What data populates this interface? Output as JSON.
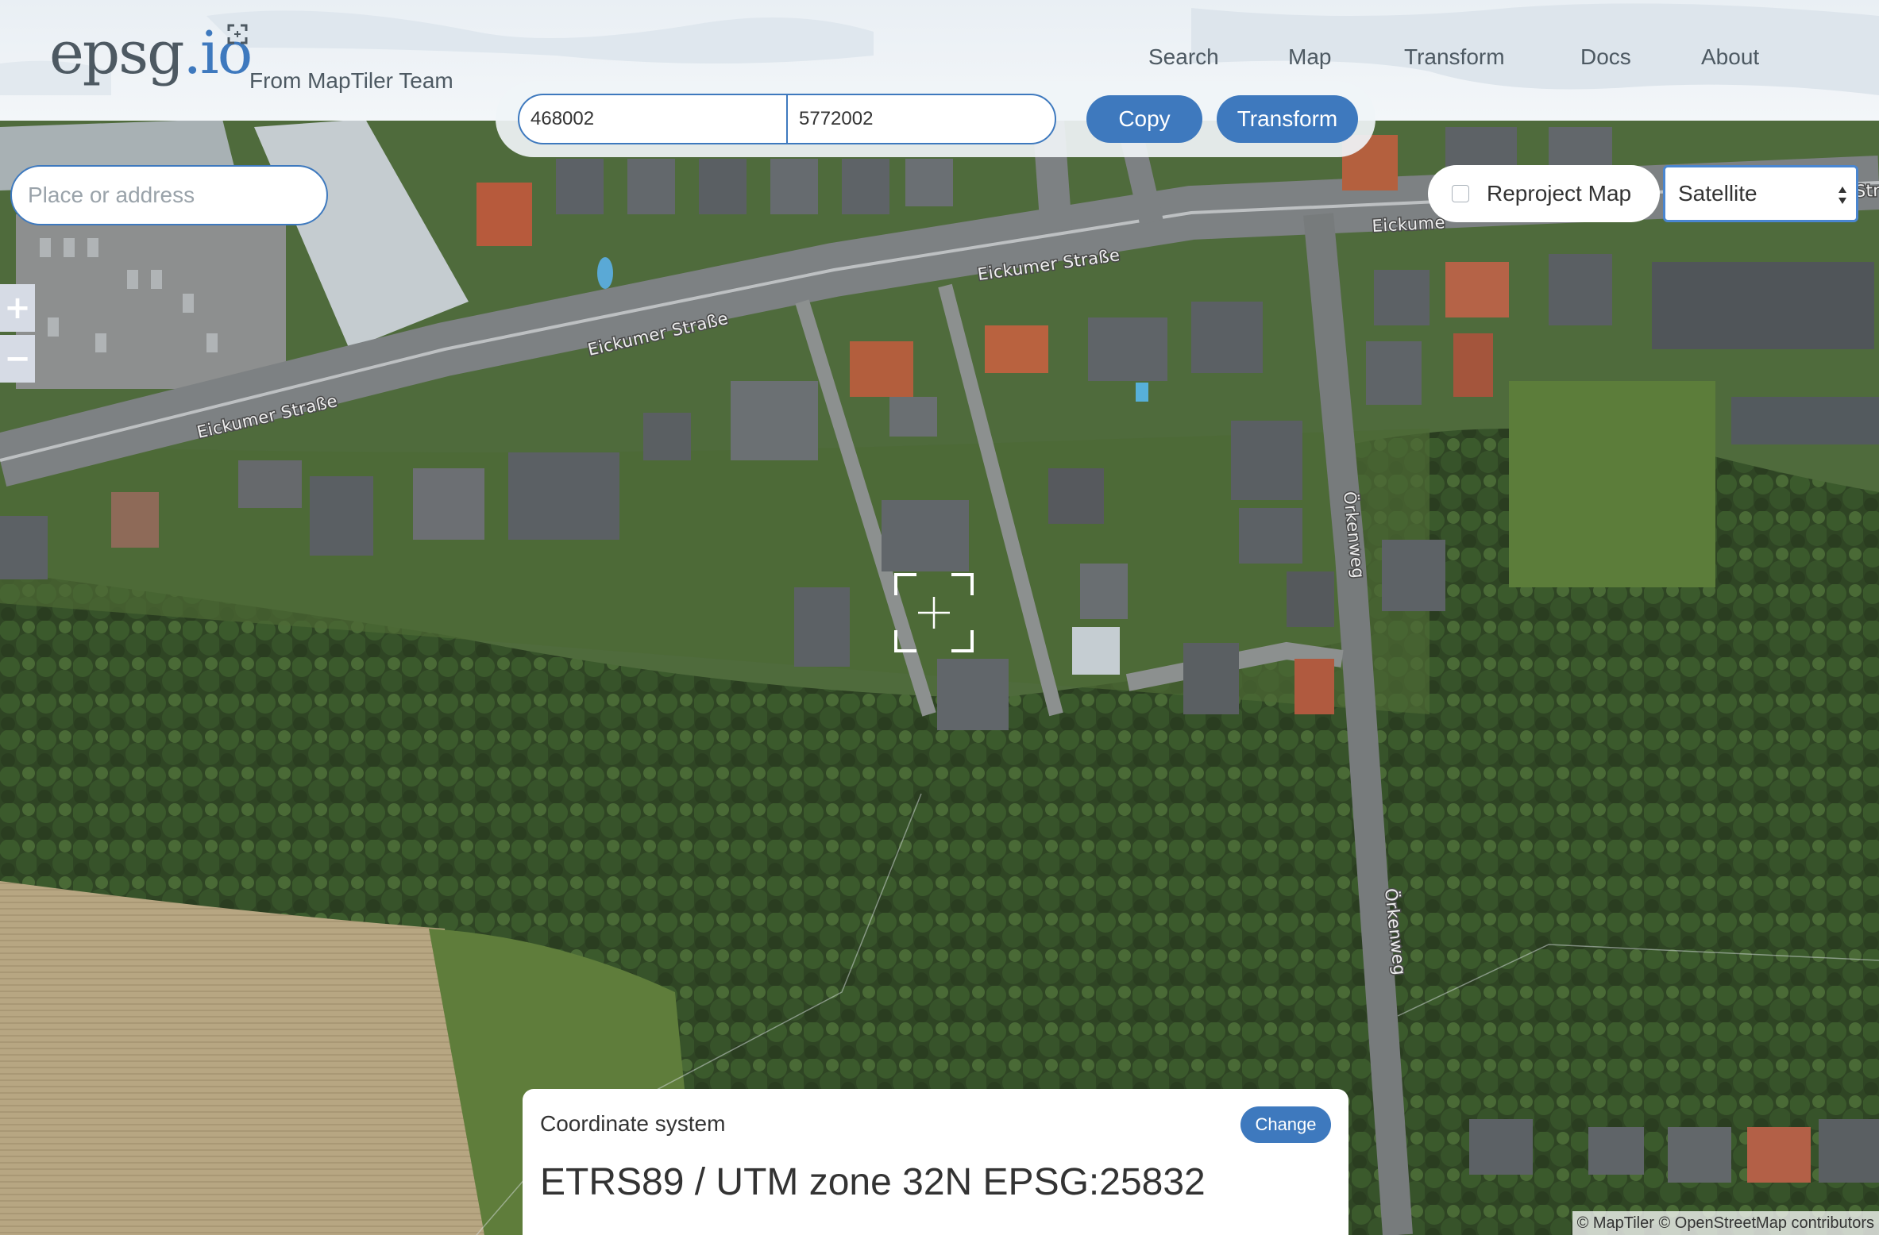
{
  "app": {
    "logo_main": "epsg",
    "logo_io": ".io",
    "tagline": "From MapTiler Team"
  },
  "nav": [
    {
      "label": "Search"
    },
    {
      "label": "Map"
    },
    {
      "label": "Transform"
    },
    {
      "label": "Docs"
    },
    {
      "label": "About"
    }
  ],
  "coords": {
    "x_value": "468002",
    "y_value": "5772002",
    "copy_label": "Copy",
    "transform_label": "Transform"
  },
  "search": {
    "placeholder": "Place or address"
  },
  "zoom": {
    "in_label": "+",
    "out_label": "−"
  },
  "map_controls": {
    "reproject_label": "Reproject Map",
    "reproject_checked": false,
    "layer_selected": "Satellite"
  },
  "streets": {
    "eickumer_1": "Eickumer Straße",
    "eickumer_2": "Eickumer Straße",
    "eickumer_3": "Eickumer Straße",
    "eickumer_4": "Eickume",
    "edge_fragment": "Str",
    "orkenweg_1": "Örkenweg",
    "orkenweg_2": "Örkenweg"
  },
  "coordinate_system": {
    "heading": "Coordinate system",
    "change_label": "Change",
    "name": "ETRS89 / UTM zone 32N EPSG:25832"
  },
  "attribution": "© MapTiler © OpenStreetMap contributors",
  "colors": {
    "accent": "#3e79be",
    "text": "#4d5962"
  },
  "icons": {
    "logo": "expand-corners-icon",
    "crosshair": "crosshair-icon",
    "select_arrows": "updown-arrows-icon"
  }
}
